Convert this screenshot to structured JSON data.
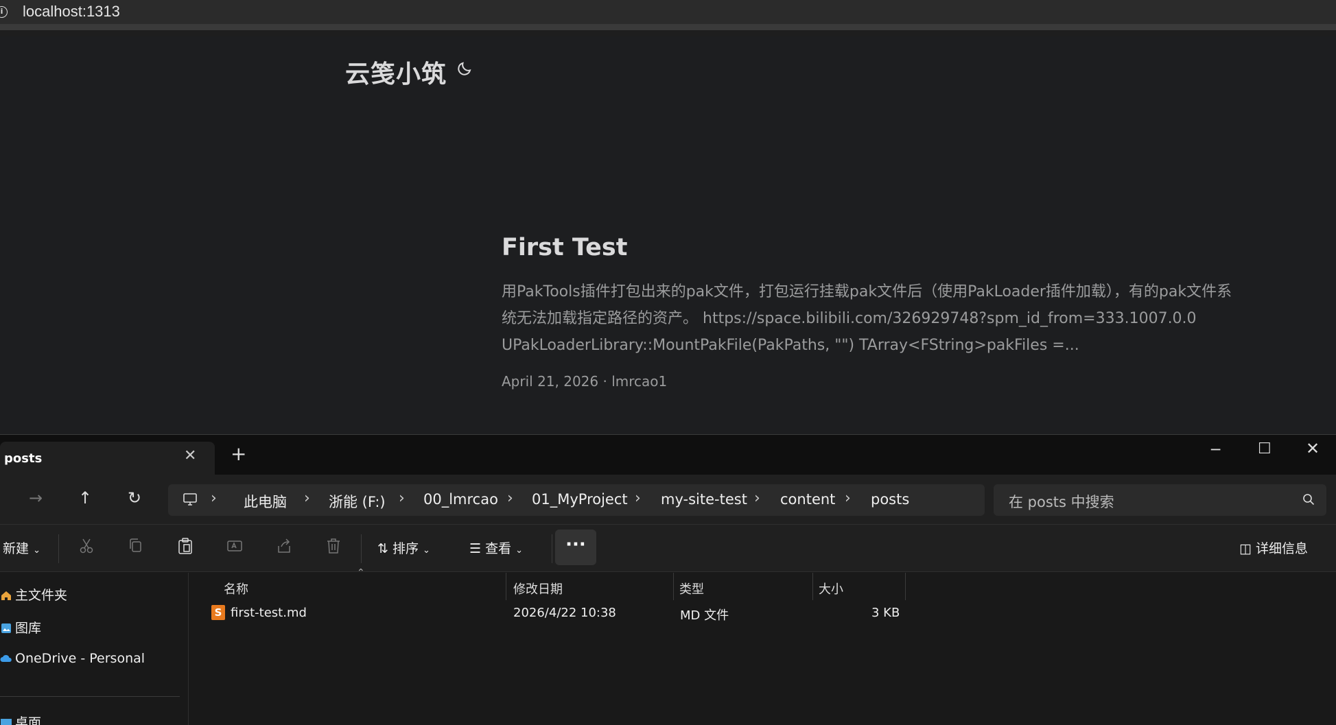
{
  "browser": {
    "url": "localhost:1313"
  },
  "blog": {
    "site_title": "云笺小筑",
    "post": {
      "title": "First Test",
      "summary": "用PakTools插件打包出来的pak文件，打包运行挂载pak文件后（使用PakLoader插件加载），有的pak文件系统无法加载指定路径的资产。 https://space.bilibili.com/326929748?spm_id_from=333.1007.0.0 UPakLoaderLibrary::MountPakFile(PakPaths, \"\") TArray<FString>pakFiles =...",
      "meta": "April 21, 2026 · lmrcao1"
    }
  },
  "explorer": {
    "tab_label": "posts",
    "breadcrumb": [
      "此电脑",
      "浙能 (F:)",
      "00_lmrcao",
      "01_MyProject",
      "my-site-test",
      "content",
      "posts"
    ],
    "search_placeholder": "在 posts 中搜索",
    "toolbar": {
      "new_label": "新建",
      "sort_label": "排序",
      "view_label": "查看",
      "more_label": "···",
      "details_label": "详细信息"
    },
    "sidebar": [
      "主文件夹",
      "图库",
      "OneDrive - Personal",
      "桌面"
    ],
    "columns": {
      "name": "名称",
      "modified": "修改日期",
      "type": "类型",
      "size": "大小"
    },
    "files": [
      {
        "icon": "S",
        "name": "first-test.md",
        "modified": "2026/4/22 10:38",
        "type": "MD 文件",
        "size": "3 KB"
      }
    ]
  }
}
